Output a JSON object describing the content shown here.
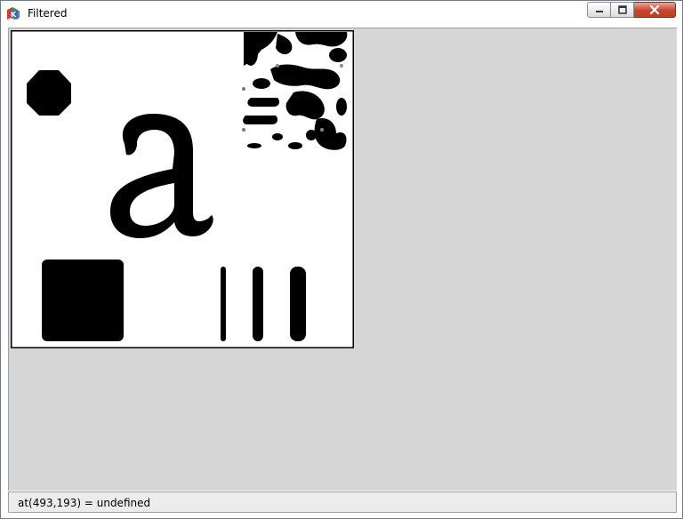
{
  "window": {
    "title": "Filtered",
    "icon": "gtk-logo-icon"
  },
  "controls": {
    "minimize_icon": "minimize-icon",
    "maximize_icon": "maximize-icon",
    "close_icon": "close-icon"
  },
  "canvas": {
    "description_icon": "filtered-image"
  },
  "status": {
    "text": "at(493,193) = undefined"
  },
  "colors": {
    "client_background": "#d6d6d6",
    "close_button": "#c8432b",
    "image_background": "#ffffff",
    "image_foreground": "#000000"
  }
}
